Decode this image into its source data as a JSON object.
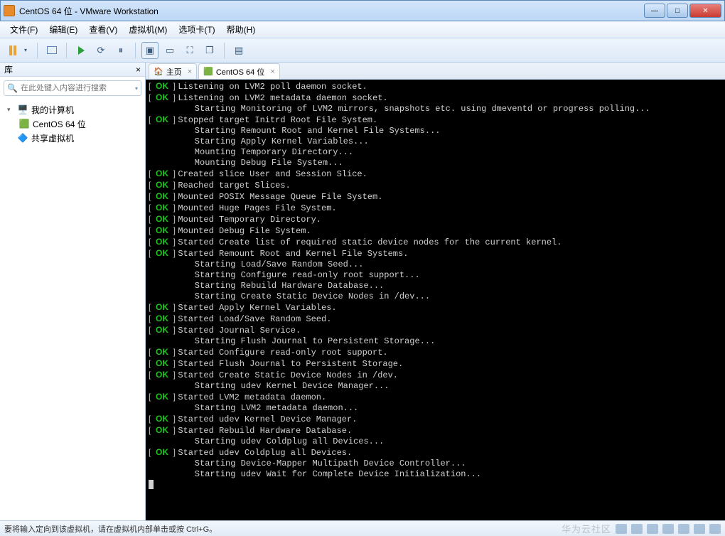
{
  "window": {
    "title": "CentOS 64 位 - VMware Workstation"
  },
  "menu": {
    "file": "文件(F)",
    "edit": "编辑(E)",
    "view": "查看(V)",
    "vm": "虚拟机(M)",
    "tabs": "选项卡(T)",
    "help": "帮助(H)"
  },
  "sidebar": {
    "header": "库",
    "search_placeholder": "在此处键入内容进行搜索",
    "root": "我的计算机",
    "vm": "CentOS 64 位",
    "shared": "共享虚拟机"
  },
  "tabbar": {
    "home": "主页",
    "vm": "CentOS 64 位"
  },
  "status": {
    "hint": "要将输入定向到该虚拟机，请在虚拟机内部单击或按 Ctrl+G。",
    "watermark": "华为云社区"
  },
  "boot": [
    {
      "ok": true,
      "msg": "Listening on LVM2 poll daemon socket."
    },
    {
      "ok": true,
      "msg": "Listening on LVM2 metadata daemon socket."
    },
    {
      "ok": null,
      "msg": "Starting Monitoring of LVM2 mirrors, snapshots etc. using dmeventd or progress polling..."
    },
    {
      "ok": true,
      "msg": "Stopped target Initrd Root File System."
    },
    {
      "ok": null,
      "msg": "Starting Remount Root and Kernel File Systems..."
    },
    {
      "ok": null,
      "msg": "Starting Apply Kernel Variables..."
    },
    {
      "ok": null,
      "msg": "Mounting Temporary Directory..."
    },
    {
      "ok": null,
      "msg": "Mounting Debug File System..."
    },
    {
      "ok": true,
      "msg": "Created slice User and Session Slice."
    },
    {
      "ok": true,
      "msg": "Reached target Slices."
    },
    {
      "ok": true,
      "msg": "Mounted POSIX Message Queue File System."
    },
    {
      "ok": true,
      "msg": "Mounted Huge Pages File System."
    },
    {
      "ok": true,
      "msg": "Mounted Temporary Directory."
    },
    {
      "ok": true,
      "msg": "Mounted Debug File System."
    },
    {
      "ok": true,
      "msg": "Started Create list of required static device nodes for the current kernel."
    },
    {
      "ok": true,
      "msg": "Started Remount Root and Kernel File Systems."
    },
    {
      "ok": null,
      "msg": "Starting Load/Save Random Seed..."
    },
    {
      "ok": null,
      "msg": "Starting Configure read-only root support..."
    },
    {
      "ok": null,
      "msg": "Starting Rebuild Hardware Database..."
    },
    {
      "ok": null,
      "msg": "Starting Create Static Device Nodes in /dev..."
    },
    {
      "ok": true,
      "msg": "Started Apply Kernel Variables."
    },
    {
      "ok": true,
      "msg": "Started Load/Save Random Seed."
    },
    {
      "ok": true,
      "msg": "Started Journal Service."
    },
    {
      "ok": null,
      "msg": "Starting Flush Journal to Persistent Storage..."
    },
    {
      "ok": true,
      "msg": "Started Configure read-only root support."
    },
    {
      "ok": true,
      "msg": "Started Flush Journal to Persistent Storage."
    },
    {
      "ok": true,
      "msg": "Started Create Static Device Nodes in /dev."
    },
    {
      "ok": null,
      "msg": "Starting udev Kernel Device Manager..."
    },
    {
      "ok": true,
      "msg": "Started LVM2 metadata daemon."
    },
    {
      "ok": null,
      "msg": "Starting LVM2 metadata daemon..."
    },
    {
      "ok": true,
      "msg": "Started udev Kernel Device Manager."
    },
    {
      "ok": true,
      "msg": "Started Rebuild Hardware Database."
    },
    {
      "ok": null,
      "msg": "Starting udev Coldplug all Devices..."
    },
    {
      "ok": true,
      "msg": "Started udev Coldplug all Devices."
    },
    {
      "ok": null,
      "msg": "Starting Device-Mapper Multipath Device Controller..."
    },
    {
      "ok": null,
      "msg": "Starting udev Wait for Complete Device Initialization..."
    }
  ]
}
